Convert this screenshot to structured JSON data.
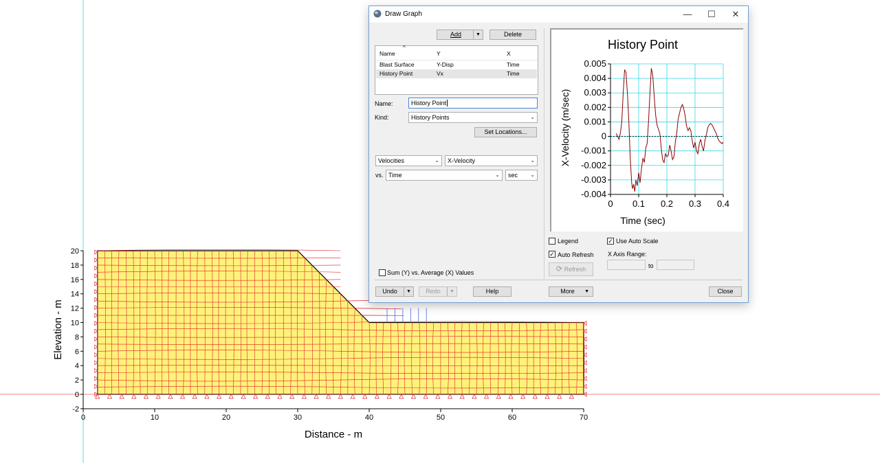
{
  "mesh_plot": {
    "x_axis_label": "Distance - m",
    "y_axis_label": "Elevation - m",
    "x_ticks": [
      "0",
      "10",
      "20",
      "30",
      "40",
      "50",
      "60",
      "70"
    ],
    "y_ticks": [
      "-2",
      "0",
      "2",
      "4",
      "6",
      "8",
      "10",
      "12",
      "14",
      "16",
      "18",
      "20"
    ]
  },
  "dialog": {
    "title": "Draw Graph",
    "buttons": {
      "add": "Add",
      "delete": "Delete",
      "set_locations": "Set Locations...",
      "undo": "Undo",
      "redo": "Redo",
      "help": "Help",
      "more": "More",
      "close": "Close",
      "refresh": "Refresh"
    },
    "list": {
      "headers": [
        "Name",
        "Y",
        "X"
      ],
      "rows": [
        {
          "name": "Blast Surface",
          "y": "Y-Disp",
          "x": "Time"
        },
        {
          "name": "History Point",
          "y": "Vx",
          "x": "Time"
        }
      ]
    },
    "name_label": "Name:",
    "name_value": "History Point",
    "kind_label": "Kind:",
    "kind_value": "History Points",
    "y_category": "Velocities",
    "y_quantity": "X-Velocity",
    "vs_label": "vs.",
    "x_quantity": "Time",
    "x_unit": "sec",
    "sum_checkbox": {
      "label": "Sum (Y) vs. Average (X) Values",
      "checked": false
    },
    "legend_checkbox": {
      "label": "Legend",
      "checked": false
    },
    "auto_refresh_checkbox": {
      "label": "Auto Refresh",
      "checked": true
    },
    "auto_scale_checkbox": {
      "label": "Use Auto Scale",
      "checked": true
    },
    "x_axis_range_label": "X Axis Range:",
    "range_to": "to"
  },
  "chart_data": {
    "type": "line",
    "title": "History Point",
    "xlabel": "Time (sec)",
    "ylabel": "X-Velocity (m/sec)",
    "xlim": [
      0,
      0.4
    ],
    "ylim": [
      -0.004,
      0.005
    ],
    "x_ticks": [
      "0",
      "0.1",
      "0.2",
      "0.3",
      "0.4"
    ],
    "y_ticks": [
      "0.005",
      "0.004",
      "0.003",
      "0.002",
      "0.001",
      "0",
      "-0.001",
      "-0.002",
      "-0.003",
      "-0.004"
    ],
    "grid": true,
    "series": [
      {
        "color": "#8b0000",
        "x": [
          0.02,
          0.025,
          0.03,
          0.035,
          0.04,
          0.045,
          0.05,
          0.055,
          0.06,
          0.065,
          0.07,
          0.075,
          0.078,
          0.082,
          0.086,
          0.09,
          0.095,
          0.1,
          0.105,
          0.11,
          0.115,
          0.12,
          0.125,
          0.13,
          0.135,
          0.14,
          0.145,
          0.15,
          0.155,
          0.16,
          0.165,
          0.17,
          0.175,
          0.18,
          0.185,
          0.19,
          0.195,
          0.2,
          0.205,
          0.21,
          0.215,
          0.22,
          0.225,
          0.23,
          0.235,
          0.24,
          0.245,
          0.25,
          0.255,
          0.26,
          0.265,
          0.27,
          0.275,
          0.28,
          0.285,
          0.29,
          0.295,
          0.3,
          0.305,
          0.31,
          0.315,
          0.32,
          0.325,
          0.33,
          0.335,
          0.34,
          0.345,
          0.35,
          0.355,
          0.36,
          0.365,
          0.37,
          0.375,
          0.38,
          0.385,
          0.39,
          0.395,
          0.4
        ],
        "y": [
          0.0002,
          0.0,
          -0.0002,
          0.0002,
          0.001,
          0.003,
          0.0046,
          0.0044,
          0.003,
          0.001,
          -0.0015,
          -0.0032,
          -0.0036,
          -0.0033,
          -0.0038,
          -0.003,
          -0.0034,
          -0.0025,
          -0.0032,
          -0.0022,
          -0.0015,
          -0.0018,
          -0.0008,
          -0.0005,
          0.001,
          0.003,
          0.0047,
          0.0042,
          0.0028,
          0.0015,
          0.0008,
          0.0005,
          0.0002,
          -0.0008,
          -0.0016,
          -0.0018,
          -0.0012,
          -0.0014,
          -0.0013,
          -0.0006,
          -0.001,
          -0.0016,
          -0.0014,
          -0.0004,
          0.0002,
          0.0012,
          0.0016,
          0.002,
          0.0022,
          0.0019,
          0.0014,
          0.0007,
          0.0004,
          0.0006,
          0.0004,
          -0.0003,
          -0.0008,
          -0.0004,
          -0.001,
          -0.0012,
          -0.0005,
          -0.0002,
          -0.0007,
          -0.001,
          -0.0003,
          0.0001,
          0.0006,
          0.0008,
          0.0009,
          0.0008,
          0.0006,
          0.0004,
          0.0002,
          -0.0001,
          -0.0003,
          -0.0004,
          -0.0005,
          -0.0004
        ]
      }
    ]
  }
}
